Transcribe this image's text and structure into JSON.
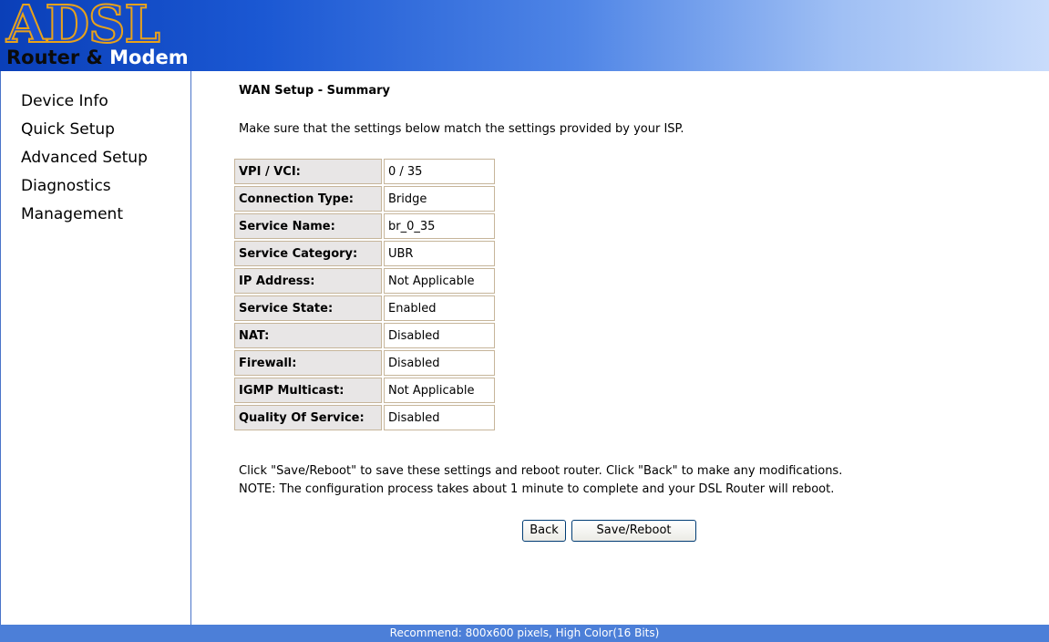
{
  "logo": {
    "text": "ADSL",
    "subtitle_part1": "Router & ",
    "subtitle_part2": "Modem"
  },
  "sidebar": {
    "items": [
      {
        "label": "Device Info"
      },
      {
        "label": "Quick Setup"
      },
      {
        "label": "Advanced Setup"
      },
      {
        "label": "Diagnostics"
      },
      {
        "label": "Management"
      }
    ]
  },
  "main": {
    "title": "WAN Setup - Summary",
    "intro": "Make sure that the settings below match the settings provided by your ISP.",
    "rows": [
      {
        "key": "VPI / VCI:",
        "value": "0 / 35"
      },
      {
        "key": "Connection Type:",
        "value": "Bridge"
      },
      {
        "key": "Service Name:",
        "value": "br_0_35"
      },
      {
        "key": "Service Category:",
        "value": "UBR"
      },
      {
        "key": "IP Address:",
        "value": "Not Applicable"
      },
      {
        "key": "Service State:",
        "value": "Enabled"
      },
      {
        "key": "NAT:",
        "value": "Disabled"
      },
      {
        "key": "Firewall:",
        "value": "Disabled"
      },
      {
        "key": "IGMP Multicast:",
        "value": "Not Applicable"
      },
      {
        "key": "Quality Of Service:",
        "value": "Disabled"
      }
    ],
    "note_line1": "Click \"Save/Reboot\" to save these settings and reboot router. Click \"Back\" to make any modifications.",
    "note_line2": "NOTE: The configuration process takes about 1 minute to complete and your DSL Router will reboot.",
    "back_label": "Back",
    "save_label": "Save/Reboot"
  },
  "footer": {
    "text": "Recommend: 800x600 pixels, High Color(16 Bits)"
  },
  "colors": {
    "header_start": "#0a3fb8",
    "header_end": "#c9dcfb",
    "footer_bg": "#4c7fd8",
    "key_cell_bg": "#e8e6e6"
  }
}
